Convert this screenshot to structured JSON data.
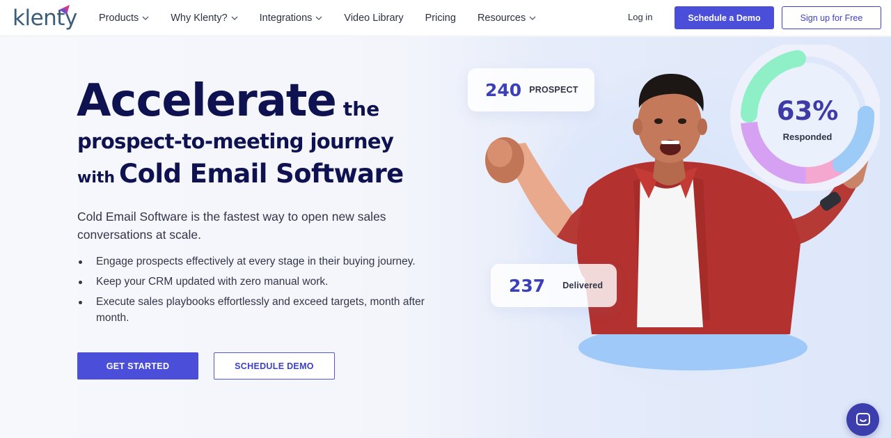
{
  "header": {
    "logo_text": "klenty",
    "nav": [
      {
        "label": "Products",
        "has_dropdown": true
      },
      {
        "label": "Why Klenty?",
        "has_dropdown": true
      },
      {
        "label": "Integrations",
        "has_dropdown": true
      },
      {
        "label": "Video Library",
        "has_dropdown": false
      },
      {
        "label": "Pricing",
        "has_dropdown": false
      },
      {
        "label": "Resources",
        "has_dropdown": true
      }
    ],
    "login_label": "Log in",
    "demo_label": "Schedule a Demo",
    "signup_label": "Sign up for Free"
  },
  "hero": {
    "headline_line1_big": "Accelerate",
    "headline_line1_small": "the",
    "headline_line2": "prospect-to-meeting journey",
    "headline_line3_small": "with",
    "headline_line3_big": "Cold Email Software",
    "subtitle": "Cold Email Software is the fastest way to open new sales conversations at scale.",
    "bullets": [
      "Engage prospects effectively at every stage in their buying journey.",
      "Keep your CRM updated with zero manual work.",
      "Execute sales playbooks effortlessly and exceed targets, month after month."
    ],
    "cta_primary": "GET STARTED",
    "cta_secondary": "SCHEDULE DEMO"
  },
  "illustration": {
    "prospect_count": "240",
    "prospect_label": "PROSPECT",
    "delivered_count": "237",
    "delivered_label": "Delivered",
    "responded_pct": "63%",
    "responded_label": "Responded"
  },
  "icons": {
    "chat": "chat-bubble-icon",
    "dropdown": "chevron-down-icon"
  },
  "colors": {
    "brand_primary": "#4b4ed9",
    "headline": "#0f1250",
    "donut_green": "#8ff0c7",
    "donut_purple": "#d6a1f3",
    "donut_pink": "#f4a7cf",
    "donut_blue": "#9ccbf7",
    "pedestal": "#9ec9f8"
  }
}
